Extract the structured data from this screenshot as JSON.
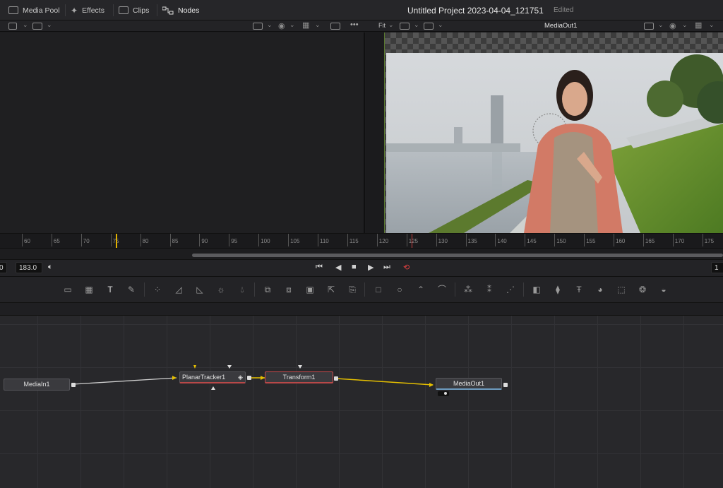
{
  "toolbar": {
    "media_pool": "Media Pool",
    "effects": "Effects",
    "clips": "Clips",
    "nodes": "Nodes"
  },
  "project": {
    "title": "Untitled Project 2023-04-04_121751",
    "status": "Edited"
  },
  "viewer_right": {
    "fit": "Fit",
    "title": "MediaOut1"
  },
  "ruler": {
    "labels": [
      "60",
      "65",
      "70",
      "75",
      "80",
      "85",
      "90",
      "95",
      "100",
      "105",
      "110",
      "115",
      "120",
      "125",
      "130",
      "135",
      "140",
      "145",
      "150",
      "155",
      "160",
      "165",
      "170",
      "175"
    ]
  },
  "transport": {
    "start_field": "0",
    "end_field": "183.0",
    "right_field": "1"
  },
  "nodes": {
    "media_in": "MediaIn1",
    "planar_tracker": "PlanarTracker1",
    "transform": "Transform1",
    "media_out": "MediaOut1"
  },
  "colors": {
    "playhead": "#e0b000",
    "loop_active": "#e04040",
    "connection_main": "#e6c000",
    "connection_input": "#cfcfcf"
  }
}
